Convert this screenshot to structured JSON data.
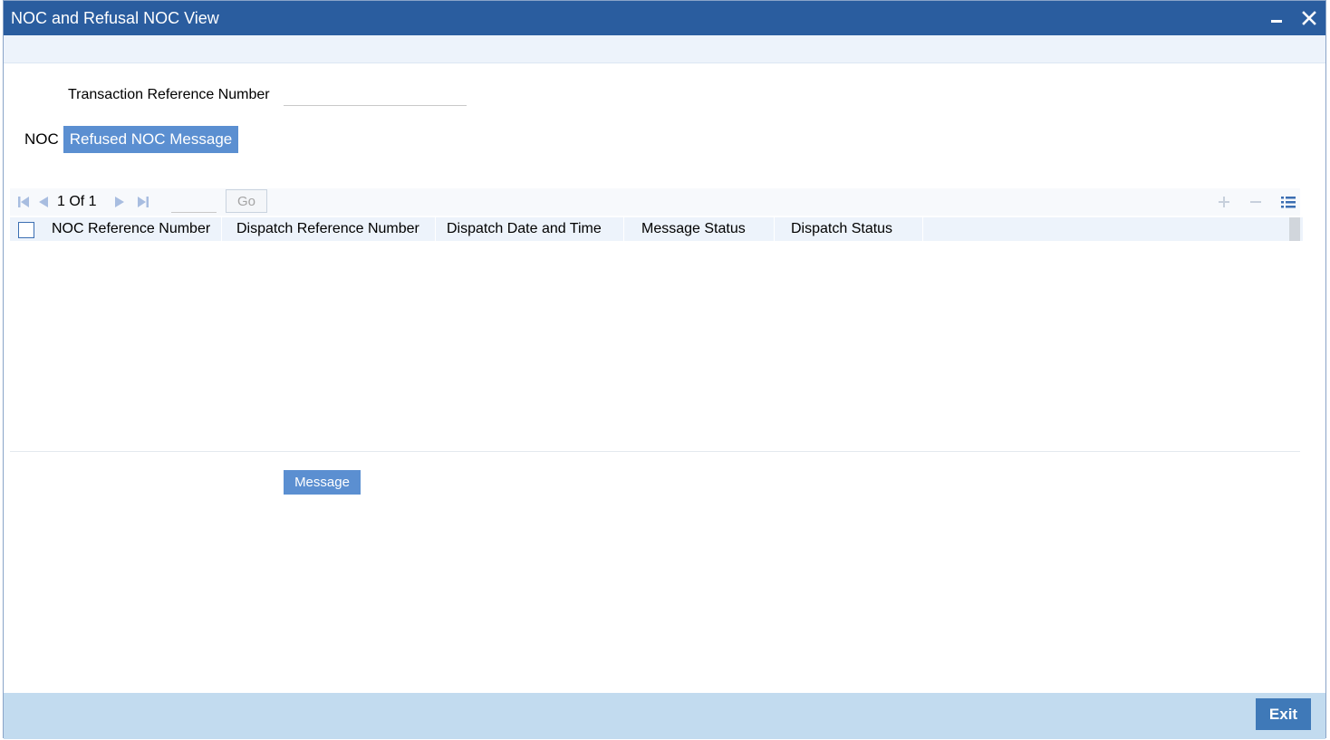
{
  "window": {
    "title": "NOC and Refusal NOC View"
  },
  "form": {
    "transaction_ref_label": "Transaction Reference Number",
    "transaction_ref_value": ""
  },
  "tabs": {
    "noc_label": "NOC",
    "refused_label": "Refused NOC Message"
  },
  "pager": {
    "page_text": "1 Of 1",
    "go_label": "Go"
  },
  "grid": {
    "columns": [
      "NOC Reference Number",
      "Dispatch Reference Number",
      "Dispatch Date and Time",
      "Message Status",
      "Dispatch Status"
    ],
    "rows": []
  },
  "actions": {
    "message_label": "Message",
    "exit_label": "Exit"
  },
  "colors": {
    "title_bar": "#2a5d9f",
    "accent_button": "#5b8fd1",
    "footer": "#c2dbef",
    "exit_button": "#3f79b8"
  }
}
